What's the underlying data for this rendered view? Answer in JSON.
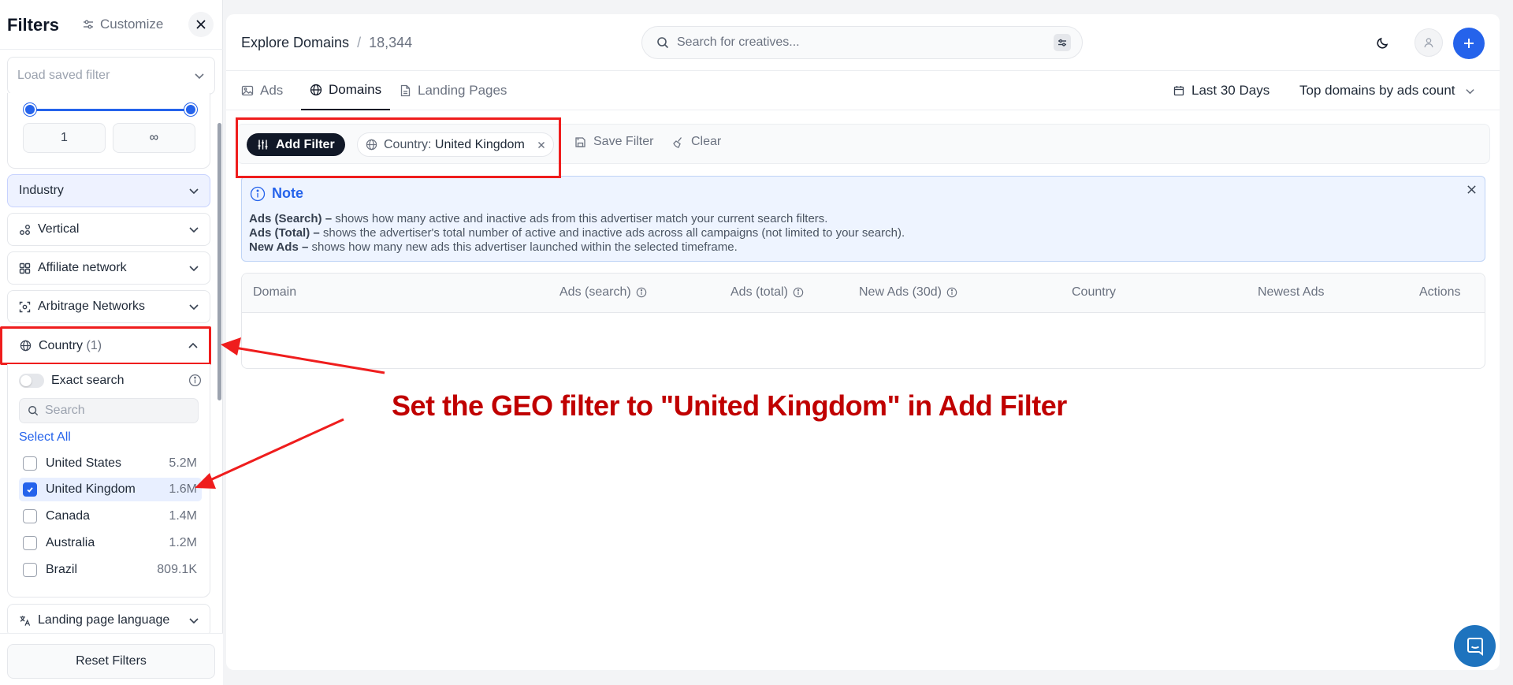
{
  "sidebar": {
    "title": "Filters",
    "customize_label": "Customize",
    "saved_filter_placeholder": "Load saved filter",
    "range": {
      "min_value": "1",
      "max_value": "∞"
    },
    "sections": {
      "industry": "Industry",
      "vertical": "Vertical",
      "affiliate": "Affiliate network",
      "arbitrage": "Arbitrage Networks",
      "country": "Country",
      "country_count": "(1)",
      "language": "Landing page language"
    },
    "country_panel": {
      "exact_search_label": "Exact search",
      "search_placeholder": "Search",
      "select_all": "Select All",
      "countries": [
        {
          "name": "United States",
          "count": "5.2M",
          "checked": false
        },
        {
          "name": "United Kingdom",
          "count": "1.6M",
          "checked": true
        },
        {
          "name": "Canada",
          "count": "1.4M",
          "checked": false
        },
        {
          "name": "Australia",
          "count": "1.2M",
          "checked": false
        },
        {
          "name": "Brazil",
          "count": "809.1K",
          "checked": false
        }
      ]
    },
    "reset_label": "Reset Filters"
  },
  "header": {
    "page_title": "Explore Domains",
    "separator": "/",
    "count": "18,344",
    "search_placeholder": "Search for creatives..."
  },
  "tabs": [
    {
      "label": "Ads",
      "icon": "image-icon",
      "active": false
    },
    {
      "label": "Domains",
      "icon": "globe-icon",
      "active": true
    },
    {
      "label": "Landing Pages",
      "icon": "document-icon",
      "active": false
    }
  ],
  "toolbar": {
    "date_range": "Last 30 Days",
    "sort": "Top domains by ads count"
  },
  "filter_bar": {
    "add_filter": "Add Filter",
    "chip_label": "Country:",
    "chip_value": "United Kingdom",
    "save_filter": "Save Filter",
    "clear": "Clear"
  },
  "note": {
    "title": "Note",
    "lines": [
      {
        "term": "Ads (Search) –",
        "text": " shows how many active and inactive ads from this advertiser match your current search filters."
      },
      {
        "term": "Ads (Total) –",
        "text": " shows the advertiser's total number of active and inactive ads across all campaigns (not limited to your search)."
      },
      {
        "term": "New Ads –",
        "text": " shows how many new ads this advertiser launched within the selected timeframe."
      }
    ]
  },
  "table": {
    "columns": [
      "Domain",
      "Ads (search)",
      "Ads (total)",
      "New Ads (30d)",
      "Country",
      "Newest Ads",
      "Actions"
    ],
    "rows": []
  },
  "annotation": {
    "text": "Set the GEO filter to \"United Kingdom\" in Add Filter",
    "color": "#c00000"
  },
  "colors": {
    "accent": "#2563eb",
    "annotation_red": "#ef1d1d",
    "dark_button": "#111827"
  }
}
